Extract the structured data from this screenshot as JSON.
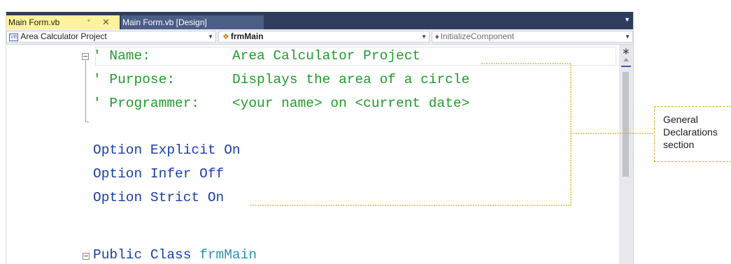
{
  "tabs": [
    {
      "label": "Main Form.vb",
      "pin_icon": "pin-icon",
      "close_icon": "close-icon",
      "active": true
    },
    {
      "label": "Main Form.vb [Design]",
      "active": false
    }
  ],
  "navbar": {
    "project": {
      "badge": "VB",
      "label": "Area Calculator Project"
    },
    "class": {
      "label": "frmMain"
    },
    "member": {
      "label": "InitializeComponent"
    }
  },
  "code": {
    "line1": {
      "tick": "' ",
      "key": "Name:",
      "value": "Area Calculator Project"
    },
    "line2": {
      "tick": "' ",
      "key": "Purpose:",
      "value": "Displays the area of a circle"
    },
    "line3": {
      "tick": "' ",
      "key": "Programmer:",
      "value": "<your name> on <current date>"
    },
    "line5": "Option Explicit On",
    "line6": "Option Infer Off",
    "line7": "Option Strict On",
    "line9": {
      "keyword": "Public Class ",
      "name": "frmMain"
    }
  },
  "callout": {
    "line1": "General",
    "line2": "Declarations",
    "line3": "section"
  },
  "colors": {
    "tab_active": "#fff29d",
    "tab_strip": "#2f3d5c",
    "comment": "#1f9c2b",
    "keyword": "#1a3fa8",
    "type": "#2b91af",
    "callout_line": "#d2a818"
  }
}
